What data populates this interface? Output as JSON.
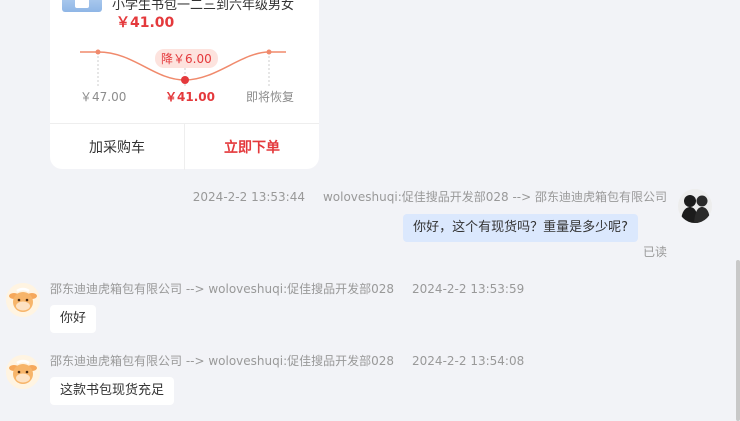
{
  "product_card": {
    "title": "小学生书包一二三到六年级男女",
    "price": "￥41.00",
    "drop_badge": "降￥6.00",
    "price_points": [
      {
        "label": "￥47.00",
        "value": 47.0
      },
      {
        "label": "￥41.00",
        "value": 41.0
      },
      {
        "label": "即将恢复",
        "value": null
      }
    ],
    "add_to_cart": "加采购车",
    "buy_now": "立即下单",
    "accent_color": "#e4393c"
  },
  "messages": [
    {
      "direction": "outgoing",
      "time": "2024-2-2 13:53:44",
      "route": "woloveshuqi:促佳搜品开发部028 --> 邵东迪迪虎箱包有限公司",
      "text": "你好，这个有现货吗？重量是多少呢?",
      "status": "已读",
      "avatar_icon": "user-dark-avatar-icon"
    },
    {
      "direction": "incoming",
      "route": "邵东迪迪虎箱包有限公司 --> woloveshuqi:促佳搜品开发部028",
      "time": "2024-2-2 13:53:59",
      "text": "你好",
      "avatar_icon": "cow-avatar-icon"
    },
    {
      "direction": "incoming",
      "route": "邵东迪迪虎箱包有限公司 --> woloveshuqi:促佳搜品开发部028",
      "time": "2024-2-2 13:54:08",
      "text": "这款书包现货充足",
      "avatar_icon": "cow-avatar-icon"
    }
  ]
}
